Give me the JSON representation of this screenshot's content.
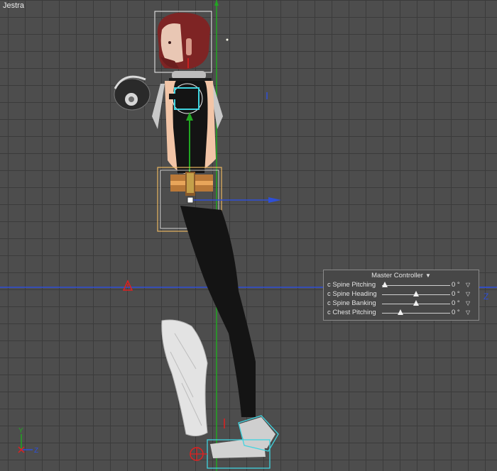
{
  "viewport": {
    "title": "Jestra",
    "axis_labels": {
      "z_right": "Z",
      "gizmo_y": "Y",
      "gizmo_z": "Z"
    }
  },
  "colors": {
    "background": "#4d4d4d",
    "grid": "#3b3b3b",
    "x_axis": "#2e4fd6",
    "y_axis": "#22a722",
    "selection": "#e8b560",
    "highlight": "#3fd4e0"
  },
  "master_controller": {
    "title": "Master Controller",
    "rows": [
      {
        "label": "Spine Pitching",
        "value": "0 °",
        "level": 0.0
      },
      {
        "label": "Spine Heading",
        "value": "0 °",
        "level": 0.5
      },
      {
        "label": "Spine Banking",
        "value": "0 °",
        "level": 0.5
      },
      {
        "label": "Chest Pitching",
        "value": "0 °",
        "level": 0.25
      }
    ]
  }
}
